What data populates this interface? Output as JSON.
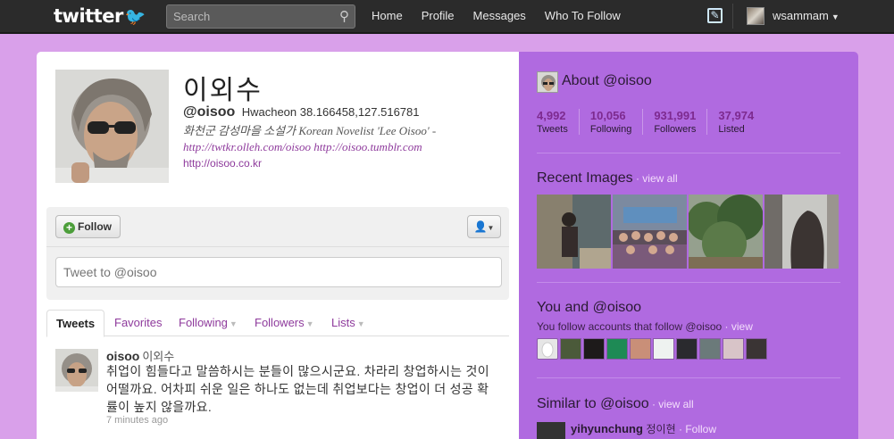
{
  "topbar": {
    "logo": "twitter",
    "search_placeholder": "Search",
    "nav": [
      "Home",
      "Profile",
      "Messages",
      "Who To Follow"
    ],
    "username": "wsammam"
  },
  "profile": {
    "name": "이외수",
    "handle": "@oisoo",
    "location": "Hwacheon 38.166458,127.516781",
    "bio_text": "화천군 감성마을 소설가 Korean Novelist 'Lee Oisoo' -",
    "bio_links": "http://twtkr.olleh.com/oisoo http://oisoo.tumblr.com",
    "url": "http://oisoo.co.kr"
  },
  "actions": {
    "follow_label": "Follow",
    "tweet_placeholder": "Tweet to @oisoo"
  },
  "tabs": [
    {
      "label": "Tweets"
    },
    {
      "label": "Favorites"
    },
    {
      "label": "Following"
    },
    {
      "label": "Followers"
    },
    {
      "label": "Lists"
    }
  ],
  "tweet": {
    "screen_name": "oisoo",
    "display_name": "이외수",
    "text": "취업이 힘들다고 말씀하시는 분들이 많으시군요. 차라리 창업하시는 것이 어떨까요. 어차피 쉬운 일은 하나도 없는데 취업보다는 창업이 더 성공 확률이 높지 않을까요.",
    "time": "7 minutes ago"
  },
  "sidebar": {
    "about_title": "About @oisoo",
    "stats": [
      {
        "num": "4,992",
        "label": "Tweets"
      },
      {
        "num": "10,056",
        "label": "Following"
      },
      {
        "num": "931,991",
        "label": "Followers"
      },
      {
        "num": "37,974",
        "label": "Listed"
      }
    ],
    "recent_images_title": "Recent Images",
    "recent_images_link": "view all",
    "you_and_title": "You and @oisoo",
    "you_follow_text": "You follow accounts that follow @oisoo",
    "you_follow_link": "view",
    "similar_title": "Similar to @oisoo",
    "similar_link": "view all",
    "similar_user": {
      "screen_name": "yihyunchung",
      "name": "정이현",
      "follow": "Follow"
    }
  }
}
